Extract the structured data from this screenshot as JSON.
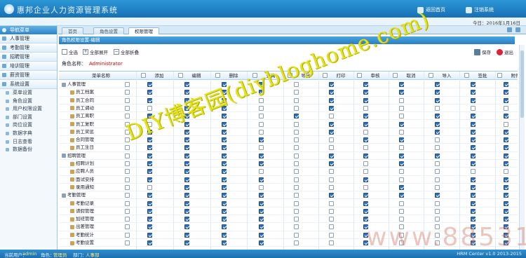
{
  "header": {
    "title": "惠邦企业人力资源管理系统",
    "btn_home": "返回首页",
    "btn_logout": "注销系统"
  },
  "subbar": {
    "date_text": "今日：2016年1月16日"
  },
  "nav": {
    "header": "导航菜单",
    "sections": [
      {
        "label": "人事管理",
        "items": []
      },
      {
        "label": "考勤管理",
        "items": []
      },
      {
        "label": "招聘管理",
        "items": []
      },
      {
        "label": "培训管理",
        "items": []
      },
      {
        "label": "薪资管理",
        "items": []
      },
      {
        "label": "系统设置",
        "items": [
          "菜单设置",
          "角色设置",
          "用户权限设置",
          "部门设置",
          "岗位设置",
          "数据字典",
          "日志查看",
          "数据备份"
        ]
      }
    ]
  },
  "tabs": [
    "首页",
    "角色设置",
    "权限管理"
  ],
  "active_tab": 2,
  "panel_title": "角色权限设置-编辑",
  "toolbar": {
    "select_all": "全选",
    "expand_all": "全部展开",
    "collapse_all": "全部折叠",
    "save": "保存",
    "close": "退出"
  },
  "role": {
    "label": "角色名称：",
    "value": "Administrator"
  },
  "grid": {
    "columns": [
      "菜单名称",
      "添加",
      "编辑",
      "删除",
      "查询",
      "导出",
      "打印",
      "审核",
      "取消",
      "导入",
      "签批",
      "附件"
    ],
    "rows": [
      {
        "label": "人事管理",
        "level": 0,
        "checks": [
          1,
          1,
          1,
          1,
          0,
          1,
          1,
          1,
          1,
          1,
          1
        ]
      },
      {
        "label": "员工档案",
        "level": 1,
        "checks": [
          1,
          1,
          1,
          1,
          0,
          1,
          1,
          1,
          1,
          1,
          1
        ]
      },
      {
        "label": "员工合同",
        "level": 1,
        "checks": [
          1,
          1,
          1,
          0,
          0,
          1,
          1,
          0,
          1,
          1,
          1
        ]
      },
      {
        "label": "员工调动",
        "level": 1,
        "checks": [
          0,
          1,
          1,
          0,
          0,
          1,
          0,
          0,
          0,
          0,
          0
        ]
      },
      {
        "label": "员工离职",
        "level": 1,
        "checks": [
          1,
          1,
          1,
          0,
          1,
          0,
          1,
          0,
          1,
          1,
          1
        ]
      },
      {
        "label": "员工复职",
        "level": 1,
        "checks": [
          0,
          1,
          1,
          0,
          0,
          1,
          1,
          1,
          1,
          1,
          0
        ]
      },
      {
        "label": "员工奖惩",
        "level": 1,
        "checks": [
          1,
          1,
          1,
          0,
          0,
          1,
          0,
          0,
          1,
          1,
          1
        ]
      },
      {
        "label": "合同管理",
        "level": 1,
        "checks": [
          1,
          1,
          1,
          1,
          0,
          0,
          1,
          1,
          0,
          1,
          1
        ]
      },
      {
        "label": "员工生日",
        "level": 1,
        "checks": [
          1,
          1,
          1,
          0,
          0,
          0,
          0,
          0,
          0,
          1,
          1
        ]
      },
      {
        "label": "招聘管理",
        "level": 0,
        "checks": [
          1,
          1,
          1,
          1,
          0,
          1,
          1,
          1,
          1,
          1,
          1
        ]
      },
      {
        "label": "招聘计划",
        "level": 1,
        "checks": [
          1,
          1,
          1,
          1,
          0,
          1,
          0,
          1,
          0,
          1,
          1
        ]
      },
      {
        "label": "应聘人员",
        "level": 1,
        "checks": [
          1,
          1,
          1,
          0,
          0,
          0,
          0,
          0,
          0,
          0,
          0
        ]
      },
      {
        "label": "面试安排",
        "level": 1,
        "checks": [
          1,
          1,
          1,
          1,
          0,
          0,
          1,
          0,
          0,
          1,
          1
        ]
      },
      {
        "label": "录用通知",
        "level": 1,
        "checks": [
          0,
          1,
          1,
          0,
          0,
          0,
          0,
          1,
          0,
          1,
          1
        ]
      },
      {
        "label": "考勤管理",
        "level": 0,
        "checks": [
          1,
          1,
          1,
          1,
          0,
          1,
          1,
          1,
          1,
          1,
          1
        ]
      },
      {
        "label": "考勤记录",
        "level": 1,
        "checks": [
          1,
          1,
          1,
          1,
          0,
          0,
          1,
          0,
          0,
          1,
          1
        ]
      },
      {
        "label": "请假管理",
        "level": 1,
        "checks": [
          1,
          1,
          1,
          1,
          0,
          0,
          1,
          0,
          0,
          1,
          1
        ]
      },
      {
        "label": "加班管理",
        "level": 1,
        "checks": [
          1,
          1,
          1,
          1,
          0,
          0,
          1,
          0,
          0,
          1,
          1
        ]
      },
      {
        "label": "出差管理",
        "level": 1,
        "checks": [
          1,
          1,
          1,
          1,
          0,
          0,
          1,
          0,
          0,
          1,
          1
        ]
      },
      {
        "label": "考勤统计",
        "level": 1,
        "checks": [
          1,
          1,
          1,
          1,
          0,
          0,
          1,
          0,
          0,
          1,
          1
        ]
      },
      {
        "label": "考勤设置",
        "level": 1,
        "checks": [
          1,
          1,
          1,
          1,
          0,
          0,
          1,
          0,
          0,
          1,
          1
        ]
      }
    ]
  },
  "status": {
    "user_label": "当前用户：",
    "user_value": "admin",
    "role_label": "角色：",
    "role_value": "管理员",
    "dept_label": "部门：",
    "dept_value": "人事部",
    "version": "HRM Center v1.0  2013-2015"
  },
  "watermarks": {
    "blog": "DIY博客园(diybloghome.com)",
    "site": "www.88531.cn"
  }
}
